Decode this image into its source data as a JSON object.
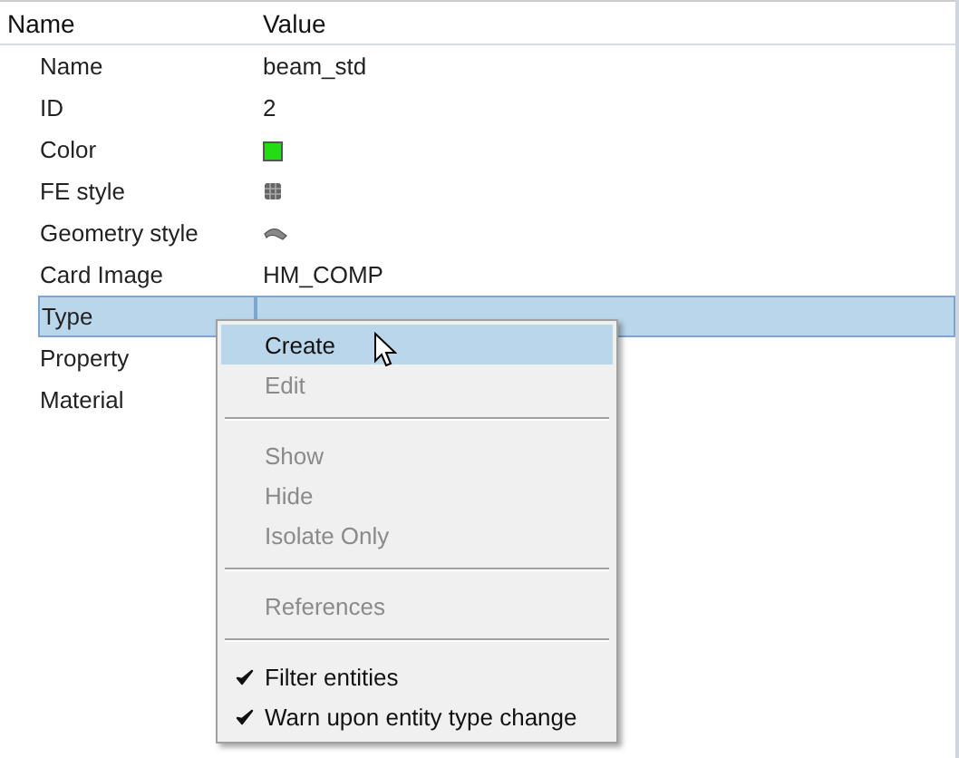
{
  "table": {
    "columns": [
      "Name",
      "Value"
    ],
    "rows": [
      {
        "name": "Name",
        "kind": "text",
        "value": "beam_std",
        "selected": false
      },
      {
        "name": "ID",
        "kind": "text",
        "value": "2",
        "selected": false
      },
      {
        "name": "Color",
        "kind": "swatch",
        "color": "#22dd11",
        "selected": false
      },
      {
        "name": "FE style",
        "kind": "fe-icon",
        "selected": false
      },
      {
        "name": "Geometry style",
        "kind": "geom-icon",
        "selected": false
      },
      {
        "name": "Card Image",
        "kind": "text",
        "value": "HM_COMP",
        "selected": false
      },
      {
        "name": "Type",
        "kind": "empty",
        "selected": true
      },
      {
        "name": "Property",
        "kind": "empty",
        "selected": false
      },
      {
        "name": "Material",
        "kind": "empty",
        "selected": false
      }
    ]
  },
  "context_menu": {
    "items": [
      {
        "kind": "item",
        "label": "Create",
        "disabled": false,
        "selected": true
      },
      {
        "kind": "item",
        "label": "Edit",
        "disabled": true,
        "selected": false
      },
      {
        "kind": "separator"
      },
      {
        "kind": "item",
        "label": "Show",
        "disabled": true,
        "selected": false
      },
      {
        "kind": "item",
        "label": "Hide",
        "disabled": true,
        "selected": false
      },
      {
        "kind": "item",
        "label": "Isolate Only",
        "disabled": true,
        "selected": false
      },
      {
        "kind": "separator"
      },
      {
        "kind": "item",
        "label": "References",
        "disabled": true,
        "selected": false
      },
      {
        "kind": "separator"
      },
      {
        "kind": "check",
        "label": "Filter entities",
        "disabled": false,
        "selected": false,
        "checked": true
      },
      {
        "kind": "check",
        "label": "Warn upon entity type change",
        "disabled": false,
        "selected": false,
        "checked": true
      }
    ]
  }
}
